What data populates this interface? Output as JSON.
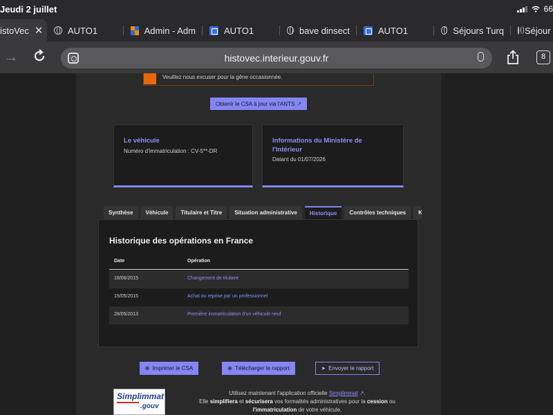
{
  "status": {
    "date": "Jeudi 2 juillet",
    "battery": "66"
  },
  "tabs": [
    {
      "label": "istoVec",
      "icon": "none",
      "active": true
    },
    {
      "label": "AUTO1",
      "icon": "globe-icon"
    },
    {
      "label": "Admin - Adm",
      "icon": "admin-favicon"
    },
    {
      "label": "AUTO1",
      "icon": "blue-favicon"
    },
    {
      "label": "bave dinsect",
      "icon": "globe-icon"
    },
    {
      "label": "AUTO1",
      "icon": "blue-favicon"
    },
    {
      "label": "Séjours Turq",
      "icon": "globe-icon"
    },
    {
      "label": "Séjour",
      "icon": "globe-icon"
    }
  ],
  "address": {
    "url": "histovec.interieur.gouv.fr",
    "tab_count": "8"
  },
  "alert": {
    "text": "Veuillez nous excuser pour la gêne occasionnée."
  },
  "csa_button": {
    "label": "Obtenir le CSA à jour via l'ANTS"
  },
  "card_vehicle": {
    "title": "Le véhicule",
    "subtitle": "Numéro d'immatriculation : CV-5**-DR"
  },
  "card_ministry": {
    "title": "Informations du Ministère de l'Intérieur",
    "subtitle": "Datant du 01/07/2026"
  },
  "page_tabs": [
    "Synthèse",
    "Véhicule",
    "Titulaire et Titre",
    "Situation administrative",
    "Historique",
    "Contrôles techniques",
    "Kilo"
  ],
  "active_tab": "Historique",
  "history": {
    "title": "Historique des opérations en France",
    "columns": [
      "Date",
      "Opération"
    ],
    "rows": [
      {
        "date": "18/06/2015",
        "operation": "Changement de titulaire"
      },
      {
        "date": "15/05/2015",
        "operation": "Achat ou reprise par un professionnel"
      },
      {
        "date": "28/05/2013",
        "operation": "Première immatriculation d'un véhicule neuf"
      }
    ]
  },
  "actions": {
    "print": "Imprimer le CSA",
    "download": "Télécharger le rapport",
    "send": "Envoyer le rapport"
  },
  "footer": {
    "logo_top": "Simplimmat",
    "logo_bottom": ".gouv",
    "line1_prefix": "Utilisez maintenant l'application officielle",
    "line1_link": "Simplimmat",
    "line2_a": "Elle",
    "line2_b": "simplifiera",
    "line2_c": "et",
    "line2_d": "sécurisera",
    "line2_e": "vos formalités administratives pour la",
    "line2_f": "cession",
    "line2_g": "ou",
    "line3_a": "l'immatriculation",
    "line3_b": "de votre véhicule."
  },
  "colors": {
    "accent": "#8585f6",
    "alert": "#e8690b",
    "background": "#1f1f1f"
  }
}
